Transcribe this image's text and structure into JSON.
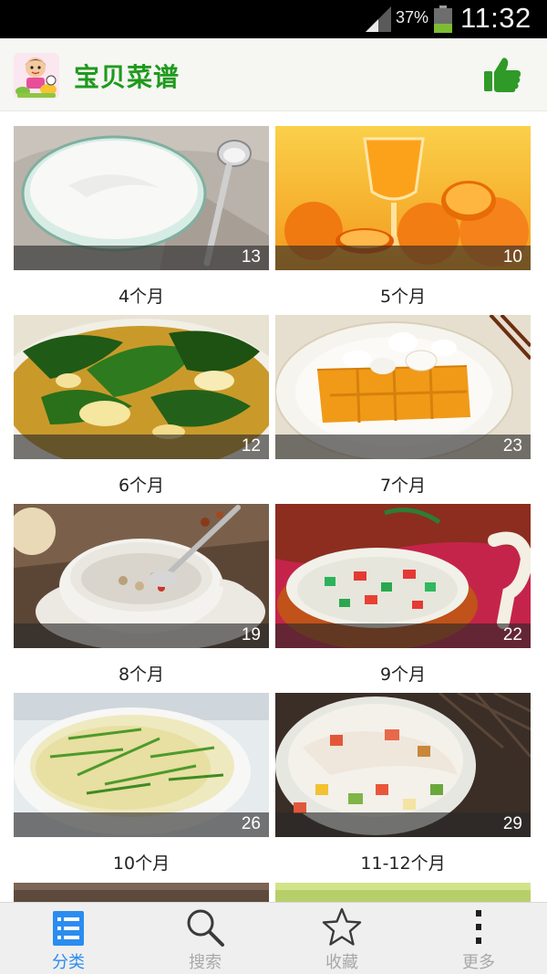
{
  "status_bar": {
    "battery_percent_text": "37%",
    "battery_level": 0.37,
    "time": "11:32"
  },
  "app_bar": {
    "title": "宝贝菜谱",
    "title_color": "#1f9a1d"
  },
  "categories": [
    {
      "label": "4个月",
      "count": "13",
      "image": "yogurt-bowl"
    },
    {
      "label": "5个月",
      "count": "10",
      "image": "orange-juice"
    },
    {
      "label": "6个月",
      "count": "12",
      "image": "spinach-soup"
    },
    {
      "label": "7个月",
      "count": "23",
      "image": "mango-plate"
    },
    {
      "label": "8个月",
      "count": "19",
      "image": "sweet-soup-cup"
    },
    {
      "label": "9个月",
      "count": "22",
      "image": "vegetable-congee"
    },
    {
      "label": "10个月",
      "count": "26",
      "image": "scallion-congee"
    },
    {
      "label": "11-12个月",
      "count": "29",
      "image": "noodle-vegetable-bowl"
    }
  ],
  "bottom_nav": {
    "active_color": "#2b8cf0",
    "items": [
      {
        "label": "分类",
        "icon": "list-icon",
        "active": true
      },
      {
        "label": "搜索",
        "icon": "search-icon",
        "active": false
      },
      {
        "label": "收藏",
        "icon": "star-icon",
        "active": false
      },
      {
        "label": "更多",
        "icon": "more-icon",
        "active": false
      }
    ]
  }
}
